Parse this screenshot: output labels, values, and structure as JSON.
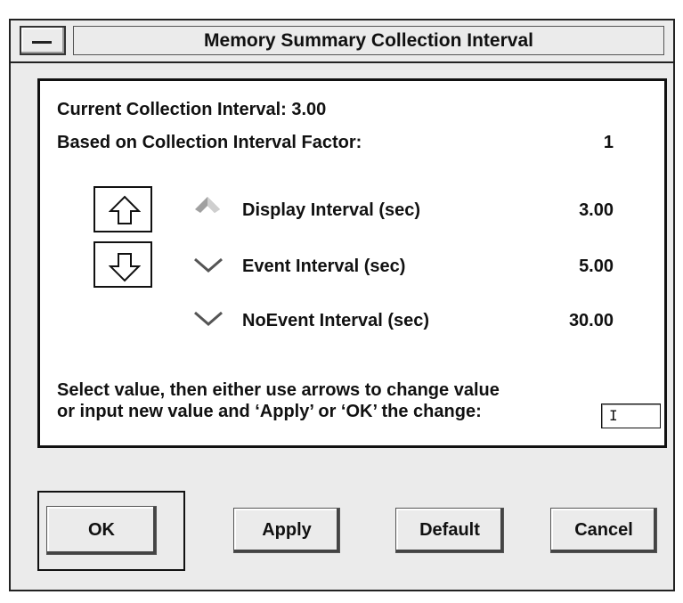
{
  "window": {
    "title": "Memory Summary Collection Interval"
  },
  "summary": {
    "current_label": "Current Collection Interval: 3.00",
    "factor_label": "Based on Collection Interval Factor:",
    "factor_value": "1"
  },
  "intervals": [
    {
      "label": "Display Interval (sec)",
      "value": "3.00",
      "indicator": "up-arrow-icon"
    },
    {
      "label": "Event Interval (sec)",
      "value": "5.00",
      "indicator": "down-chevron-icon"
    },
    {
      "label": "NoEvent Interval (sec)",
      "value": "30.00",
      "indicator": "down-chevron-icon"
    }
  ],
  "instructions": {
    "line1": "Select value, then either use arrows to change value",
    "line2": "or input new value and ‘Apply’ or ‘OK’ the change:"
  },
  "input": {
    "value": "I"
  },
  "buttons": {
    "ok": "OK",
    "apply": "Apply",
    "default": "Default",
    "cancel": "Cancel"
  },
  "colors": {
    "dialog_bg": "#ebebeb",
    "panel_bg": "#ffffff",
    "text": "#111111",
    "indicator_gray": "#a0a0a0",
    "indicator_dark": "#555555"
  }
}
